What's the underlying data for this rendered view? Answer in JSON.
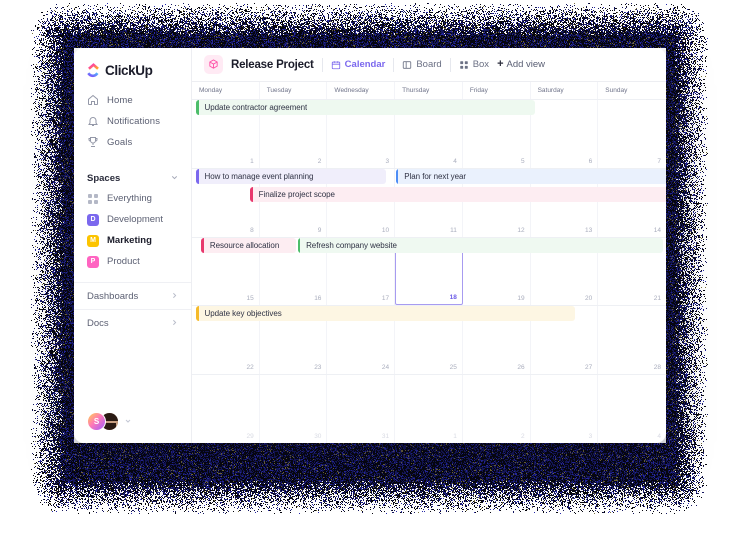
{
  "brand": {
    "name": "ClickUp",
    "icon": "clickup-logo-icon"
  },
  "sidebar": {
    "nav": [
      {
        "label": "Home",
        "icon": "home-icon"
      },
      {
        "label": "Notifications",
        "icon": "bell-icon"
      },
      {
        "label": "Goals",
        "icon": "trophy-icon"
      }
    ],
    "spaces_section": {
      "title": "Spaces",
      "chevron": "chevron-down-icon"
    },
    "everything": {
      "label": "Everything",
      "icon": "grid-icon"
    },
    "spaces": [
      {
        "label": "Development",
        "initial": "D",
        "color": "#7b68ee",
        "active": false
      },
      {
        "label": "Marketing",
        "initial": "M",
        "color": "#fcc400",
        "active": true
      },
      {
        "label": "Product",
        "initial": "P",
        "color": "#ff64c1",
        "active": false
      }
    ],
    "bottom_links": [
      {
        "label": "Dashboards",
        "chevron": "chevron-right-icon"
      },
      {
        "label": "Docs",
        "chevron": "chevron-right-icon"
      }
    ],
    "avatars": [
      {
        "name": "avatar-initial",
        "initial": "S"
      },
      {
        "name": "avatar-photo",
        "initial": ""
      }
    ],
    "avatar_caret": "chevron-down-icon"
  },
  "toolbar": {
    "project_icon": "cube-icon",
    "project_title": "Release Project",
    "views": [
      {
        "label": "Calendar",
        "icon": "calendar-icon",
        "active": true
      },
      {
        "label": "Board",
        "icon": "board-icon",
        "active": false
      },
      {
        "label": "Box",
        "icon": "box-icon",
        "active": false
      }
    ],
    "add_view": {
      "label": "Add view",
      "icon": "plus-icon"
    }
  },
  "calendar": {
    "day_names": [
      "Monday",
      "Tuesday",
      "Wednesday",
      "Thursday",
      "Friday",
      "Saturday",
      "Sunday"
    ],
    "today": {
      "week": 2,
      "col": 3,
      "day": 18
    },
    "weeks": [
      {
        "days": [
          {
            "num": "1",
            "muted": false
          },
          {
            "num": "2",
            "muted": false
          },
          {
            "num": "3",
            "muted": false
          },
          {
            "num": "4",
            "muted": false
          },
          {
            "num": "5",
            "muted": false
          },
          {
            "num": "6",
            "muted": false
          },
          {
            "num": "7",
            "muted": false
          }
        ],
        "events": [
          {
            "title": "Update contractor agreement",
            "start": 0,
            "span": 5,
            "accent": "#4dbd6a",
            "bg": "#eef9f0",
            "row": 0
          }
        ]
      },
      {
        "days": [
          {
            "num": "8",
            "muted": false
          },
          {
            "num": "9",
            "muted": false
          },
          {
            "num": "10",
            "muted": false
          },
          {
            "num": "11",
            "muted": false
          },
          {
            "num": "12",
            "muted": false
          },
          {
            "num": "13",
            "muted": false
          },
          {
            "num": "14",
            "muted": false
          }
        ],
        "events": [
          {
            "title": "How to manage event planning",
            "start": 0,
            "span": 2.8,
            "accent": "#7b68ee",
            "bg": "#f0eefb",
            "row": 0
          },
          {
            "title": "Plan for next year",
            "start": 2.95,
            "span": 4.05,
            "accent": "#4d8df5",
            "bg": "#eaf1fd",
            "row": 0
          },
          {
            "title": "Finalize project scope",
            "start": 0.8,
            "span": 6.2,
            "accent": "#e8386d",
            "bg": "#fdedf2",
            "row": 1
          }
        ]
      },
      {
        "days": [
          {
            "num": "15",
            "muted": false
          },
          {
            "num": "16",
            "muted": false
          },
          {
            "num": "17",
            "muted": false
          },
          {
            "num": "18",
            "muted": false
          },
          {
            "num": "19",
            "muted": false
          },
          {
            "num": "20",
            "muted": false
          },
          {
            "num": "21",
            "muted": false
          }
        ],
        "events": [
          {
            "title": "Resource allocation",
            "start": 0.08,
            "span": 1.4,
            "accent": "#e8386d",
            "bg": "#fdedf2",
            "row": 0
          },
          {
            "title": "Refresh company website",
            "start": 1.5,
            "span": 5.4,
            "accent": "#4dbd6a",
            "bg": "#eff9f1",
            "row": 0
          }
        ]
      },
      {
        "days": [
          {
            "num": "22",
            "muted": false
          },
          {
            "num": "23",
            "muted": false
          },
          {
            "num": "24",
            "muted": false
          },
          {
            "num": "25",
            "muted": false
          },
          {
            "num": "26",
            "muted": false
          },
          {
            "num": "27",
            "muted": false
          },
          {
            "num": "28",
            "muted": false
          }
        ],
        "events": [
          {
            "title": "Update key objectives",
            "start": 0,
            "span": 5.6,
            "accent": "#f5ba2b",
            "bg": "#fdf6e3",
            "row": 0
          }
        ]
      },
      {
        "days": [
          {
            "num": "29",
            "muted": true
          },
          {
            "num": "30",
            "muted": true
          },
          {
            "num": "31",
            "muted": true
          },
          {
            "num": "1",
            "muted": true
          },
          {
            "num": "2",
            "muted": true
          },
          {
            "num": "3",
            "muted": true
          },
          {
            "num": "4",
            "muted": true
          }
        ],
        "events": []
      }
    ]
  },
  "colors": {
    "accent": "#7b68ee",
    "backdrop": "#0a0a18",
    "noise_blue": "#2a2ab0"
  }
}
